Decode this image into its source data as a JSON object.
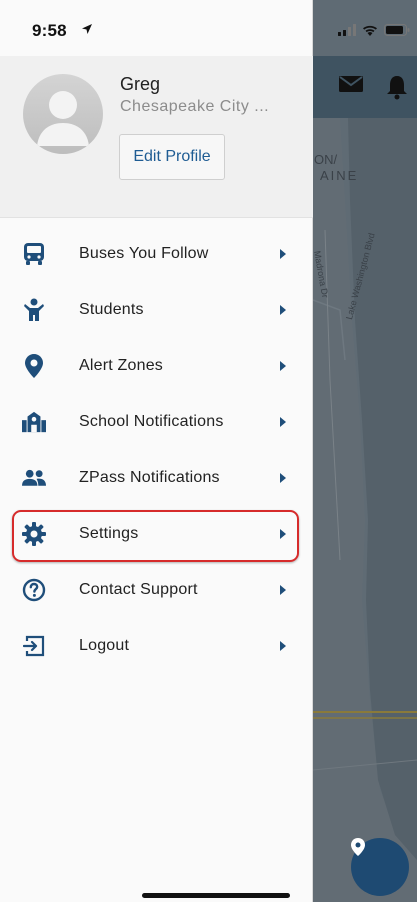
{
  "status_bar": {
    "time": "9:58"
  },
  "profile": {
    "name": "Greg",
    "location": "Chesapeake City ...",
    "edit_button": "Edit Profile"
  },
  "menu": {
    "items": [
      {
        "label": "Buses You Follow",
        "icon": "bus-icon"
      },
      {
        "label": "Students",
        "icon": "child-icon"
      },
      {
        "label": "Alert Zones",
        "icon": "map-pin-icon"
      },
      {
        "label": "School Notifications",
        "icon": "school-icon"
      },
      {
        "label": "ZPass Notifications",
        "icon": "users-icon"
      },
      {
        "label": "Settings",
        "icon": "gear-icon",
        "highlighted": true
      },
      {
        "label": "Contact Support",
        "icon": "question-circle-icon"
      },
      {
        "label": "Logout",
        "icon": "logout-icon"
      }
    ]
  },
  "map": {
    "labels": [
      "ON/",
      "AINE",
      "Madrona Dr",
      "Lake Washington Blvd"
    ]
  },
  "colors": {
    "accent": "#1f4e7a",
    "highlight": "#d62b2b",
    "edit_button_text": "#1f5c93"
  }
}
